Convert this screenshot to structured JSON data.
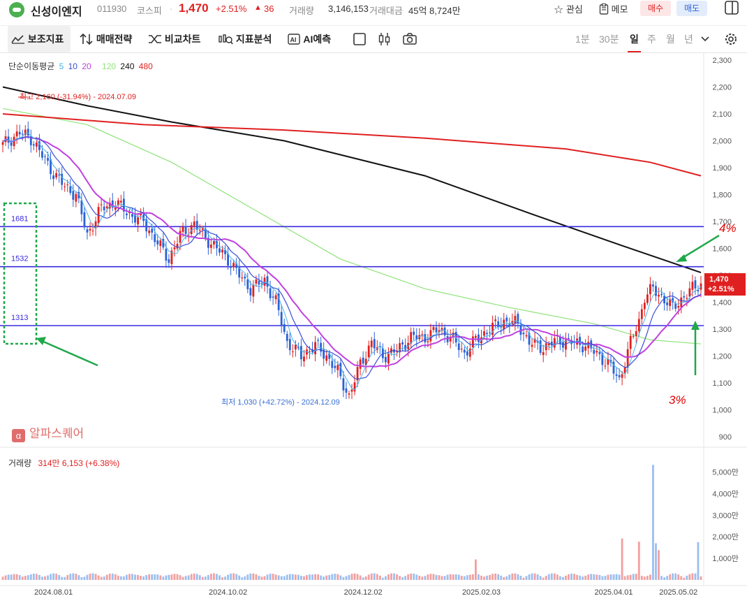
{
  "header": {
    "name": "신성이엔지",
    "code": "011930",
    "market": "코스피",
    "separator": "·",
    "price": "1,470",
    "change_pct": "+2.51%",
    "change_val": "36",
    "volume_label": "거래량",
    "volume": "3,146,153",
    "amount_label": "거래대금",
    "amount": "45억 8,724만",
    "watch_label": "관심",
    "memo_label": "메모",
    "buy_label": "매수",
    "sell_label": "매도"
  },
  "toolbar": {
    "indicator_label": "보조지표",
    "strategy_label": "매매전략",
    "compare_label": "비교차트",
    "analysis_label": "지표분석",
    "ai_label": "AI예측",
    "periods": [
      "1분",
      "30분",
      "일",
      "주",
      "월",
      "년"
    ],
    "selected_period": "일"
  },
  "legend": {
    "title": "단순이동평균",
    "items": [
      {
        "label": "5",
        "color": "#4ab3e8"
      },
      {
        "label": "10",
        "color": "#3b4fd6"
      },
      {
        "label": "20",
        "color": "#c040e0"
      },
      {
        "label": "120",
        "color": "#8fe37a"
      },
      {
        "label": "240",
        "color": "#111111"
      },
      {
        "label": "480",
        "color": "#e02020"
      }
    ]
  },
  "volume_panel": {
    "label": "거래량",
    "value": "314만 6,153",
    "change": "(+6.38%)",
    "ticks": [
      "5,000만",
      "4,000만",
      "3,000만",
      "2,000만",
      "1,000만"
    ]
  },
  "brand": "알파스퀘어",
  "chart_data": {
    "type": "candlestick",
    "y_ticks": [
      "2,300",
      "2,200",
      "2,100",
      "2,000",
      "1,900",
      "1,800",
      "1,700",
      "1,600",
      "1,500",
      "1,400",
      "1,300",
      "1,200",
      "1,100",
      "1,000",
      "900"
    ],
    "ylim": [
      900,
      2300
    ],
    "x_ticks": [
      "2024.08.01",
      "2024.10.02",
      "2024.12.02",
      "2025.02.03",
      "2025.04.01",
      "2025.05.02"
    ],
    "high_annotation": "최고 2,160 (-31.94%) - 2024.07.09",
    "low_annotation": "최저 1,030 (+42.72%) - 2024.12.09",
    "last_price": "1,470",
    "last_change": "+2.51%",
    "horizontal_lines": [
      {
        "label": "1681",
        "value": 1681
      },
      {
        "label": "1532",
        "value": 1532
      },
      {
        "label": "1313",
        "value": 1313
      }
    ],
    "anchors": [
      [
        0,
        1985
      ],
      [
        6,
        2030
      ],
      [
        10,
        2010
      ],
      [
        18,
        1880
      ],
      [
        22,
        1830
      ],
      [
        26,
        1800
      ],
      [
        30,
        1650
      ],
      [
        35,
        1750
      ],
      [
        40,
        1770
      ],
      [
        46,
        1720
      ],
      [
        50,
        1700
      ],
      [
        55,
        1620
      ],
      [
        59,
        1560
      ],
      [
        63,
        1650
      ],
      [
        68,
        1690
      ],
      [
        72,
        1640
      ],
      [
        76,
        1600
      ],
      [
        80,
        1560
      ],
      [
        84,
        1500
      ],
      [
        88,
        1450
      ],
      [
        93,
        1480
      ],
      [
        97,
        1400
      ],
      [
        101,
        1250
      ],
      [
        106,
        1200
      ],
      [
        111,
        1240
      ],
      [
        115,
        1200
      ],
      [
        119,
        1140
      ],
      [
        123,
        1050
      ],
      [
        127,
        1170
      ],
      [
        131,
        1250
      ],
      [
        135,
        1200
      ],
      [
        140,
        1220
      ],
      [
        145,
        1270
      ],
      [
        150,
        1270
      ],
      [
        155,
        1300
      ],
      [
        160,
        1260
      ],
      [
        164,
        1210
      ],
      [
        168,
        1260
      ],
      [
        173,
        1300
      ],
      [
        178,
        1330
      ],
      [
        183,
        1320
      ],
      [
        187,
        1250
      ],
      [
        192,
        1230
      ],
      [
        197,
        1260
      ],
      [
        202,
        1250
      ],
      [
        207,
        1240
      ],
      [
        212,
        1200
      ],
      [
        216,
        1160
      ],
      [
        219,
        1110
      ],
      [
        223,
        1250
      ],
      [
        226,
        1330
      ],
      [
        228,
        1420
      ],
      [
        231,
        1450
      ],
      [
        234,
        1420
      ],
      [
        238,
        1380
      ],
      [
        242,
        1420
      ],
      [
        245,
        1450
      ],
      [
        248,
        1470
      ]
    ],
    "ma120": [
      [
        0,
        2120
      ],
      [
        30,
        2060
      ],
      [
        60,
        1920
      ],
      [
        90,
        1740
      ],
      [
        120,
        1560
      ],
      [
        150,
        1450
      ],
      [
        180,
        1380
      ],
      [
        210,
        1320
      ],
      [
        230,
        1260
      ],
      [
        248,
        1245
      ]
    ],
    "ma240": [
      [
        0,
        2200
      ],
      [
        30,
        2130
      ],
      [
        60,
        2070
      ],
      [
        100,
        2000
      ],
      [
        150,
        1870
      ],
      [
        190,
        1720
      ],
      [
        220,
        1610
      ],
      [
        248,
        1510
      ]
    ],
    "ma480": [
      [
        0,
        2100
      ],
      [
        50,
        2060
      ],
      [
        100,
        2040
      ],
      [
        150,
        2010
      ],
      [
        200,
        1970
      ],
      [
        230,
        1920
      ],
      [
        248,
        1870
      ]
    ],
    "volume_spikes": [
      {
        "x": 168,
        "v": 950
      },
      {
        "x": 220,
        "v": 1920
      },
      {
        "x": 226,
        "v": 1770
      },
      {
        "x": 231,
        "v": 5330
      },
      {
        "x": 232,
        "v": 1700
      },
      {
        "x": 233,
        "v": 1380
      },
      {
        "x": 247,
        "v": 1750
      }
    ],
    "volume_max": 5500,
    "handwritten_left": "4%",
    "handwritten_right": "3%"
  }
}
